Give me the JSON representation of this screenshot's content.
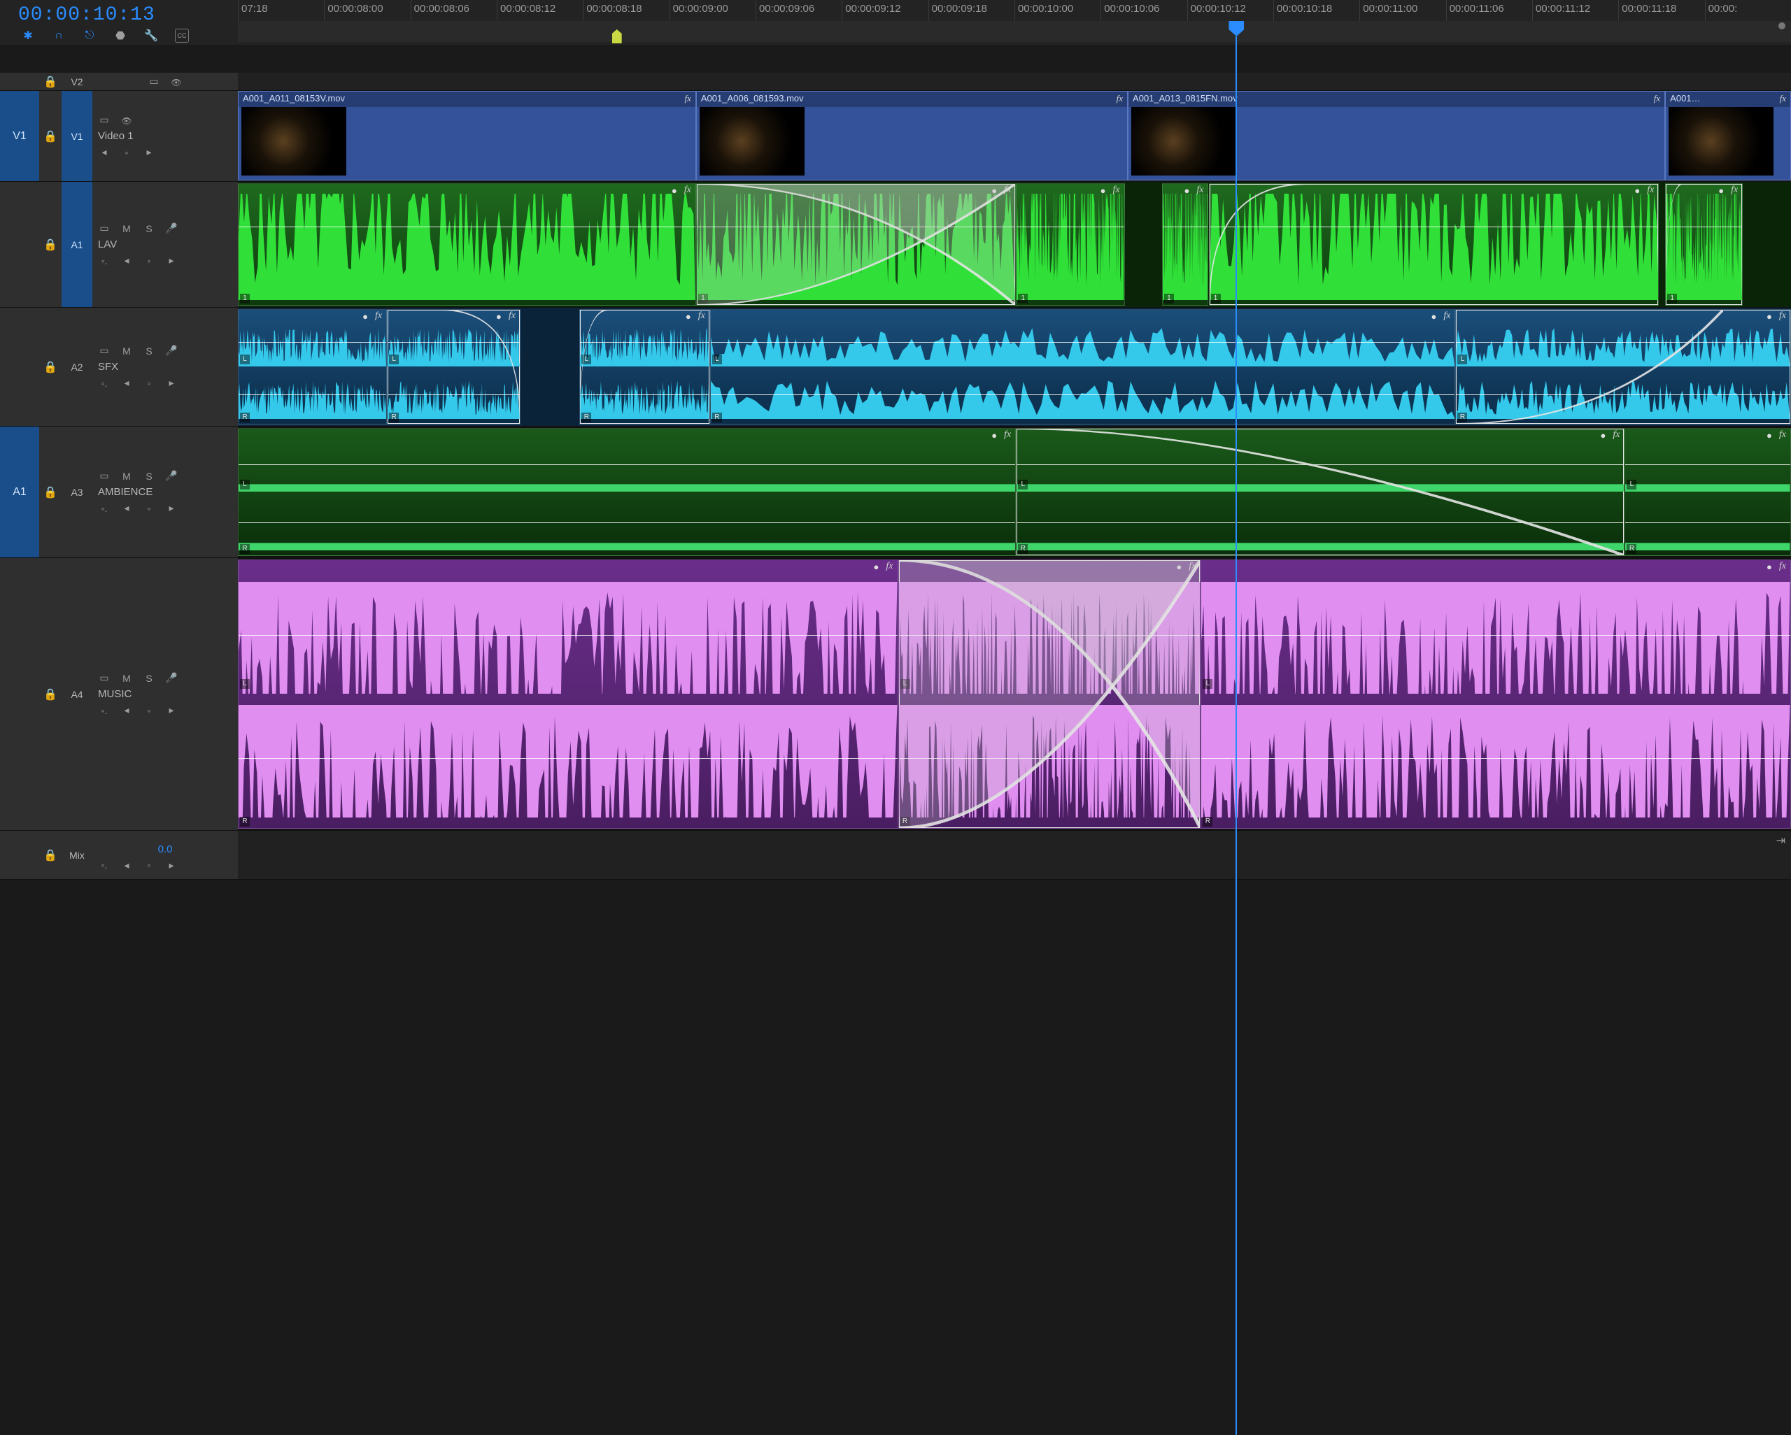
{
  "timecode": "00:00:10:13",
  "toolbar_icons": [
    "insert-mode",
    "snap",
    "linked-selection",
    "marker",
    "wrench",
    "cc"
  ],
  "ruler_ticks": [
    "07:18",
    "00:00:08:00",
    "00:00:08:06",
    "00:00:08:12",
    "00:00:08:18",
    "00:00:09:00",
    "00:00:09:06",
    "00:00:09:12",
    "00:00:09:18",
    "00:00:10:00",
    "00:00:10:06",
    "00:00:10:12",
    "00:00:10:18",
    "00:00:11:00",
    "00:00:11:06",
    "00:00:11:12",
    "00:00:11:18",
    "00:00:"
  ],
  "playhead_pct": 64.3,
  "marker_pct": 24.4,
  "tracks": {
    "v2": {
      "id": "V2"
    },
    "v1": {
      "src": "V1",
      "id": "V1",
      "name": "Video 1"
    },
    "a1": {
      "id": "A1",
      "name": "LAV"
    },
    "a2": {
      "id": "A2",
      "name": "SFX"
    },
    "a3": {
      "src": "A1",
      "id": "A3",
      "name": "AMBIENCE"
    },
    "a4": {
      "id": "A4",
      "name": "MUSIC"
    }
  },
  "ctrl_labels": {
    "mute": "M",
    "solo": "S",
    "keyframe_token": "◦"
  },
  "v1_clips": [
    {
      "name": "A001_A011_08153V.mov",
      "left": 0,
      "width": 29.5
    },
    {
      "name": "A001_A006_081593.mov",
      "left": 29.5,
      "width": 27.8
    },
    {
      "name": "A001_A013_0815FN.mov",
      "left": 57.3,
      "width": 34.6
    },
    {
      "name": "A001…",
      "left": 91.9,
      "width": 8.1
    }
  ],
  "a1_clips": [
    {
      "left": 0,
      "width": 29.5,
      "sel": false
    },
    {
      "left": 29.5,
      "width": 20.6,
      "sel": true,
      "xfade": true
    },
    {
      "left": 50.1,
      "width": 7.0,
      "sel": false
    },
    {
      "left": 59.5,
      "width": 3.0,
      "sel": false
    },
    {
      "left": 62.5,
      "width": 29.0,
      "sel": true,
      "fadein": true
    },
    {
      "left": 91.9,
      "width": 5,
      "sel": true,
      "fadein": true
    }
  ],
  "a2_clips": [
    {
      "left": 0,
      "width": 9.6,
      "sel": false,
      "ch": "LR"
    },
    {
      "left": 9.6,
      "width": 8.6,
      "sel": true,
      "fadeout": true,
      "ch": "LR"
    },
    {
      "left": 22.0,
      "width": 8.4,
      "sel": true,
      "fadein": true,
      "ch": "LR"
    },
    {
      "left": 30.4,
      "width": 48.0,
      "sel": false,
      "ch": "LR"
    },
    {
      "left": 78.4,
      "width": 21.6,
      "sel": true,
      "fadein_long": true,
      "ch": "LR"
    }
  ],
  "a3_clips": [
    {
      "left": 0,
      "width": 50.1,
      "sel": false,
      "ch": "LR"
    },
    {
      "left": 50.1,
      "width": 39.2,
      "sel": true,
      "fadeout_long": true,
      "ch": "LR"
    },
    {
      "left": 89.3,
      "width": 10.7,
      "sel": false,
      "ch": "LR"
    }
  ],
  "a4_clips": [
    {
      "left": 0,
      "width": 42.5,
      "sel": false,
      "ch": "LR"
    },
    {
      "left": 42.5,
      "width": 19.5,
      "sel": true,
      "xfade": true,
      "ch": "LR"
    },
    {
      "left": 62.0,
      "width": 38.0,
      "sel": false,
      "ch": "LR"
    }
  ],
  "mix": {
    "label": "Mix",
    "value": "0.0"
  },
  "fx_label": "fx",
  "channel_labels": {
    "mono": "1",
    "left": "L",
    "right": "R"
  },
  "colors": {
    "accent": "#2a8cff",
    "video": "#33529a",
    "lav": "#1f6a1f",
    "lav_wave": "#30e038",
    "sfx": "#1a4e7a",
    "sfx_wave": "#34c8ea",
    "amb": "#1a5a1a",
    "amb_wave": "#3ed66a",
    "music": "#6a2e8a",
    "music_wave": "#e08ef0"
  }
}
